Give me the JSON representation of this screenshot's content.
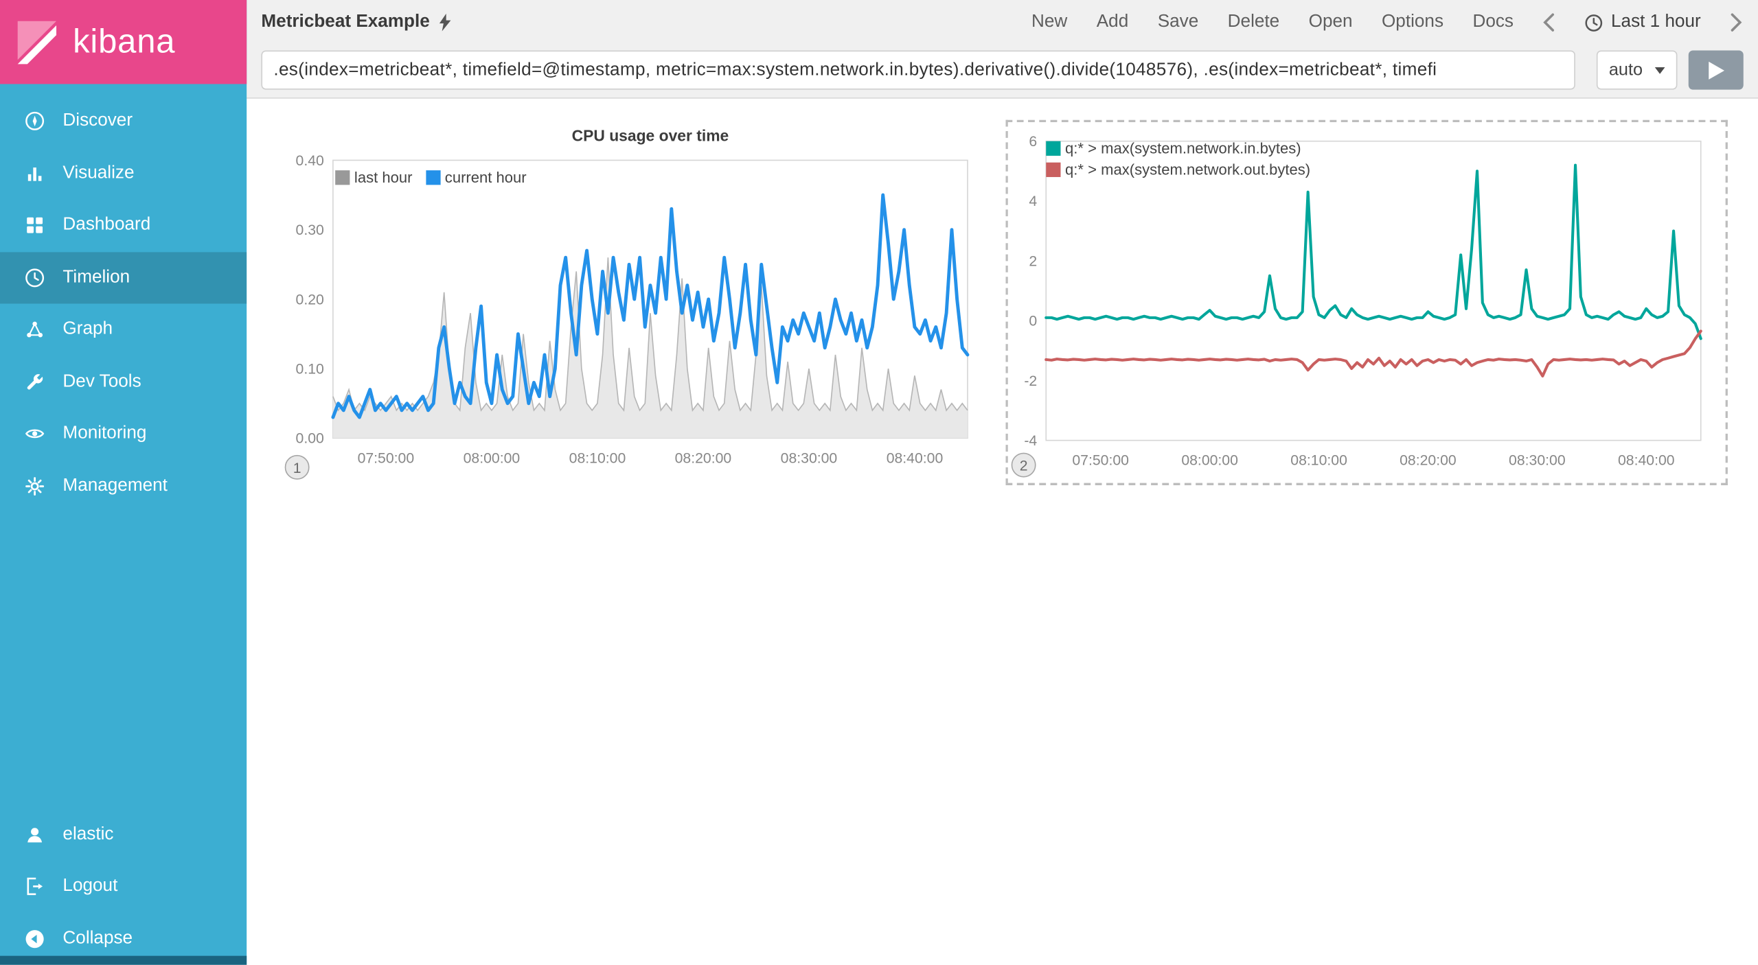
{
  "sidebar": {
    "brand": "kibana",
    "items": [
      {
        "label": "Discover",
        "icon": "compass-icon"
      },
      {
        "label": "Visualize",
        "icon": "bar-chart-icon"
      },
      {
        "label": "Dashboard",
        "icon": "dashboard-icon"
      },
      {
        "label": "Timelion",
        "icon": "clock-icon",
        "selected": true
      },
      {
        "label": "Graph",
        "icon": "graph-icon"
      },
      {
        "label": "Dev Tools",
        "icon": "wrench-icon"
      },
      {
        "label": "Monitoring",
        "icon": "eye-icon"
      },
      {
        "label": "Management",
        "icon": "gear-icon"
      }
    ],
    "footer_items": [
      {
        "label": "elastic",
        "icon": "user-icon"
      },
      {
        "label": "Logout",
        "icon": "logout-icon"
      },
      {
        "label": "Collapse",
        "icon": "collapse-icon"
      }
    ]
  },
  "topbar": {
    "title": "Metricbeat Example",
    "menu": [
      "New",
      "Add",
      "Save",
      "Delete",
      "Open",
      "Options",
      "Docs"
    ],
    "timepicker": "Last 1 hour"
  },
  "querybar": {
    "query": ".es(index=metricbeat*, timefield=@timestamp, metric=max:system.network.in.bytes).derivative().divide(1048576), .es(index=metricbeat*, timefi",
    "interval": "auto"
  },
  "colors": {
    "sidebar": "#3caed2",
    "sidebar_selected": "rgba(0,0,0,0.16)",
    "sidebar_footer_accent": "#1a6480",
    "brand_pink": "#e8478b",
    "series_blue": "#2491e9",
    "series_gray": "#999999",
    "series_teal": "#00a69b",
    "series_red": "#c95f5f"
  },
  "chart_data": [
    {
      "type": "line",
      "title": "CPU usage over time",
      "panel_number": "1",
      "x_tick_labels": [
        "07:50:00",
        "08:00:00",
        "08:10:00",
        "08:20:00",
        "08:30:00",
        "08:40:00"
      ],
      "x_tick_fractions": [
        0.0833,
        0.25,
        0.4167,
        0.5833,
        0.75,
        0.9167
      ],
      "y_tick_labels": [
        "0.40",
        "0.30",
        "0.20",
        "0.10",
        "0.00"
      ],
      "ylim": [
        0,
        0.4
      ],
      "legend_position": "top-left-row",
      "grid": false,
      "series": [
        {
          "name": "last hour",
          "type": "area",
          "color": "#999999",
          "fill": "#e8e8e8",
          "stroke_width": 1,
          "values": [
            0.06,
            0.04,
            0.05,
            0.07,
            0.04,
            0.05,
            0.04,
            0.06,
            0.05,
            0.04,
            0.05,
            0.06,
            0.04,
            0.05,
            0.04,
            0.05,
            0.04,
            0.05,
            0.06,
            0.08,
            0.12,
            0.21,
            0.1,
            0.05,
            0.04,
            0.13,
            0.18,
            0.08,
            0.04,
            0.05,
            0.04,
            0.05,
            0.12,
            0.06,
            0.04,
            0.05,
            0.15,
            0.08,
            0.04,
            0.05,
            0.04,
            0.14,
            0.07,
            0.04,
            0.05,
            0.16,
            0.24,
            0.1,
            0.05,
            0.04,
            0.05,
            0.12,
            0.26,
            0.12,
            0.05,
            0.04,
            0.13,
            0.06,
            0.04,
            0.05,
            0.18,
            0.09,
            0.04,
            0.05,
            0.04,
            0.12,
            0.23,
            0.1,
            0.04,
            0.05,
            0.04,
            0.13,
            0.06,
            0.04,
            0.05,
            0.14,
            0.07,
            0.04,
            0.05,
            0.04,
            0.12,
            0.22,
            0.09,
            0.04,
            0.05,
            0.04,
            0.11,
            0.05,
            0.04,
            0.05,
            0.1,
            0.05,
            0.04,
            0.05,
            0.04,
            0.12,
            0.06,
            0.04,
            0.05,
            0.04,
            0.13,
            0.07,
            0.04,
            0.05,
            0.04,
            0.1,
            0.05,
            0.04,
            0.05,
            0.04,
            0.09,
            0.05,
            0.04,
            0.05,
            0.04,
            0.07,
            0.04,
            0.05,
            0.04,
            0.05,
            0.04
          ]
        },
        {
          "name": "current hour",
          "type": "line",
          "color": "#2491e9",
          "stroke_width": 3,
          "values": [
            0.03,
            0.05,
            0.04,
            0.06,
            0.04,
            0.03,
            0.05,
            0.07,
            0.04,
            0.05,
            0.04,
            0.05,
            0.06,
            0.04,
            0.05,
            0.04,
            0.05,
            0.06,
            0.04,
            0.05,
            0.13,
            0.16,
            0.1,
            0.05,
            0.08,
            0.06,
            0.05,
            0.13,
            0.19,
            0.08,
            0.05,
            0.12,
            0.07,
            0.05,
            0.06,
            0.15,
            0.1,
            0.05,
            0.08,
            0.06,
            0.12,
            0.06,
            0.1,
            0.22,
            0.26,
            0.18,
            0.12,
            0.22,
            0.27,
            0.2,
            0.15,
            0.24,
            0.18,
            0.26,
            0.21,
            0.17,
            0.25,
            0.2,
            0.26,
            0.16,
            0.22,
            0.18,
            0.26,
            0.2,
            0.33,
            0.24,
            0.18,
            0.22,
            0.17,
            0.21,
            0.16,
            0.2,
            0.14,
            0.18,
            0.26,
            0.2,
            0.13,
            0.18,
            0.25,
            0.17,
            0.12,
            0.25,
            0.19,
            0.13,
            0.08,
            0.16,
            0.14,
            0.17,
            0.15,
            0.18,
            0.16,
            0.14,
            0.18,
            0.13,
            0.16,
            0.2,
            0.17,
            0.15,
            0.18,
            0.14,
            0.17,
            0.13,
            0.16,
            0.22,
            0.35,
            0.28,
            0.2,
            0.24,
            0.3,
            0.22,
            0.16,
            0.15,
            0.17,
            0.14,
            0.16,
            0.13,
            0.18,
            0.3,
            0.2,
            0.13,
            0.12
          ]
        }
      ]
    },
    {
      "type": "line",
      "title": "",
      "panel_number": "2",
      "selected": true,
      "x_tick_labels": [
        "07:50:00",
        "08:00:00",
        "08:10:00",
        "08:20:00",
        "08:30:00",
        "08:40:00"
      ],
      "x_tick_fractions": [
        0.0833,
        0.25,
        0.4167,
        0.5833,
        0.75,
        0.9167
      ],
      "y_tick_labels": [
        "6",
        "4",
        "2",
        "0",
        "-2",
        "-4"
      ],
      "ylim": [
        -4,
        6
      ],
      "legend_position": "top-left-column",
      "grid": false,
      "series": [
        {
          "name": "q:* > max(system.network.in.bytes)",
          "type": "line",
          "color": "#00a69b",
          "stroke_width": 2.5,
          "values": [
            0.1,
            0.1,
            0.05,
            0.1,
            0.15,
            0.1,
            0.05,
            0.1,
            0.1,
            0.05,
            0.1,
            0.15,
            0.1,
            0.05,
            0.1,
            0.1,
            0.05,
            0.1,
            0.15,
            0.1,
            0.1,
            0.05,
            0.1,
            0.15,
            0.1,
            0.05,
            0.1,
            0.1,
            0.05,
            0.2,
            0.35,
            0.15,
            0.1,
            0.05,
            0.1,
            0.1,
            0.05,
            0.1,
            0.15,
            0.1,
            0.3,
            1.5,
            0.4,
            0.1,
            0.05,
            0.1,
            0.1,
            0.3,
            4.3,
            0.8,
            0.2,
            0.1,
            0.35,
            0.5,
            0.2,
            0.1,
            0.4,
            0.2,
            0.1,
            0.05,
            0.1,
            0.15,
            0.1,
            0.05,
            0.1,
            0.15,
            0.1,
            0.05,
            0.1,
            0.1,
            0.3,
            0.15,
            0.1,
            0.05,
            0.1,
            0.2,
            2.2,
            0.4,
            2.4,
            5.0,
            0.6,
            0.2,
            0.1,
            0.15,
            0.1,
            0.05,
            0.1,
            0.2,
            1.7,
            0.4,
            0.15,
            0.1,
            0.05,
            0.1,
            0.15,
            0.2,
            0.4,
            5.2,
            0.8,
            0.2,
            0.1,
            0.15,
            0.1,
            0.05,
            0.2,
            0.3,
            0.15,
            0.1,
            0.05,
            0.1,
            0.4,
            0.2,
            0.1,
            0.15,
            0.3,
            3.0,
            0.5,
            0.2,
            0.1,
            -0.1,
            -0.6
          ]
        },
        {
          "name": "q:* > max(system.network.out.bytes)",
          "type": "line",
          "color": "#c95f5f",
          "stroke_width": 2.5,
          "values": [
            -1.3,
            -1.32,
            -1.28,
            -1.3,
            -1.31,
            -1.29,
            -1.3,
            -1.32,
            -1.3,
            -1.28,
            -1.3,
            -1.31,
            -1.29,
            -1.3,
            -1.32,
            -1.3,
            -1.28,
            -1.3,
            -1.31,
            -1.29,
            -1.3,
            -1.32,
            -1.3,
            -1.28,
            -1.3,
            -1.31,
            -1.29,
            -1.3,
            -1.32,
            -1.3,
            -1.28,
            -1.3,
            -1.31,
            -1.29,
            -1.3,
            -1.32,
            -1.3,
            -1.28,
            -1.3,
            -1.31,
            -1.29,
            -1.35,
            -1.3,
            -1.32,
            -1.3,
            -1.28,
            -1.3,
            -1.4,
            -1.65,
            -1.45,
            -1.3,
            -1.32,
            -1.3,
            -1.28,
            -1.3,
            -1.35,
            -1.6,
            -1.4,
            -1.55,
            -1.3,
            -1.45,
            -1.25,
            -1.5,
            -1.35,
            -1.55,
            -1.3,
            -1.45,
            -1.3,
            -1.5,
            -1.35,
            -1.3,
            -1.4,
            -1.3,
            -1.35,
            -1.3,
            -1.32,
            -1.45,
            -1.3,
            -1.5,
            -1.4,
            -1.35,
            -1.3,
            -1.32,
            -1.28,
            -1.3,
            -1.31,
            -1.3,
            -1.32,
            -1.35,
            -1.3,
            -1.55,
            -1.85,
            -1.45,
            -1.3,
            -1.32,
            -1.3,
            -1.28,
            -1.3,
            -1.31,
            -1.3,
            -1.32,
            -1.3,
            -1.28,
            -1.3,
            -1.31,
            -1.45,
            -1.35,
            -1.5,
            -1.4,
            -1.3,
            -1.35,
            -1.55,
            -1.4,
            -1.3,
            -1.25,
            -1.2,
            -1.15,
            -1.1,
            -0.9,
            -0.6,
            -0.35
          ]
        }
      ]
    }
  ]
}
